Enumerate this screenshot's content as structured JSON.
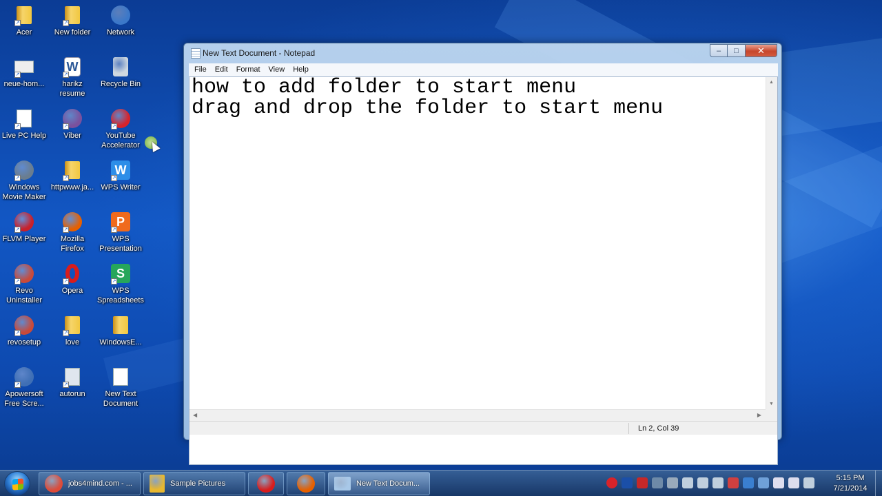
{
  "desktop": {
    "icons": [
      {
        "label": "Acer",
        "kind": "folder"
      },
      {
        "label": "New folder",
        "kind": "folder"
      },
      {
        "label": "Network",
        "kind": "network"
      },
      {
        "label": "neue-hom...",
        "kind": "image"
      },
      {
        "label": "harikz\nresume",
        "kind": "word"
      },
      {
        "label": "Recycle Bin",
        "kind": "recycle"
      },
      {
        "label": "Live PC Help",
        "kind": "doc"
      },
      {
        "label": "Viber",
        "kind": "viber"
      },
      {
        "label": "YouTube\nAccelerator",
        "kind": "youtube"
      },
      {
        "label": "Windows\nMovie Maker",
        "kind": "moviemaker"
      },
      {
        "label": "httpwww.ja...",
        "kind": "folder"
      },
      {
        "label": "WPS Writer",
        "kind": "wpswriter"
      },
      {
        "label": "FLVM Player",
        "kind": "flvm"
      },
      {
        "label": "Mozilla\nFirefox",
        "kind": "firefox"
      },
      {
        "label": "WPS\nPresentation",
        "kind": "wpspres"
      },
      {
        "label": "Revo\nUninstaller",
        "kind": "revo"
      },
      {
        "label": "Opera",
        "kind": "opera"
      },
      {
        "label": "WPS\nSpreadsheets",
        "kind": "wpssheet"
      },
      {
        "label": "revosetup",
        "kind": "revo"
      },
      {
        "label": "love",
        "kind": "folder"
      },
      {
        "label": "WindowsE...",
        "kind": "folder"
      },
      {
        "label": "Apowersoft\nFree Scre...",
        "kind": "apower"
      },
      {
        "label": "autorun",
        "kind": "autorun"
      },
      {
        "label": "New Text\nDocument",
        "kind": "doc"
      }
    ]
  },
  "notepad": {
    "title": "New Text Document - Notepad",
    "menu": [
      "File",
      "Edit",
      "Format",
      "View",
      "Help"
    ],
    "content": "how to add folder to start menu\ndrag and drop the folder to start menu",
    "status_position": "Ln 2, Col 39",
    "caption_min": "–",
    "caption_max": "□",
    "caption_close": "✕"
  },
  "taskbar": {
    "buttons": [
      {
        "label": "jobs4mind.com - ...",
        "icon": "chrome-icon",
        "color": "#dd4b39",
        "active": false
      },
      {
        "label": "Sample Pictures",
        "icon": "folder-icon",
        "color": "#e8b830",
        "active": false
      },
      {
        "label": "",
        "icon": "opera-icon",
        "color": "#d81d1d",
        "active": false
      },
      {
        "label": "",
        "icon": "firefox-icon",
        "color": "#e66000",
        "active": false
      },
      {
        "label": "New Text Docum...",
        "icon": "notepad-icon",
        "color": "#a8c8e8",
        "active": true
      }
    ],
    "tray_icons": [
      {
        "name": "youtube-accelerator-tray-icon",
        "color": "#d8232a"
      },
      {
        "name": "bluetooth-icon",
        "color": "#1b4fa8"
      },
      {
        "name": "pdf-tray-icon",
        "color": "#c62828"
      },
      {
        "name": "usb-tray-icon",
        "color": "#6e8aa8"
      },
      {
        "name": "network-drive-icon",
        "color": "#9ab"
      },
      {
        "name": "volume-icon",
        "color": "#c0cfdd"
      },
      {
        "name": "display-icon",
        "color": "#c0cfdd"
      },
      {
        "name": "speaker-icon",
        "color": "#c0cfdd"
      },
      {
        "name": "flag-icon",
        "color": "#d04040"
      },
      {
        "name": "windows-update-icon",
        "color": "#3a7fd0"
      },
      {
        "name": "shield-icon",
        "color": "#6fa0d8"
      },
      {
        "name": "clipboard-icon",
        "color": "#dde"
      },
      {
        "name": "signal-icon",
        "color": "#dde"
      },
      {
        "name": "monitor-icon",
        "color": "#c0cfdd"
      }
    ],
    "time": "5:15 PM",
    "date": "7/21/2014"
  }
}
